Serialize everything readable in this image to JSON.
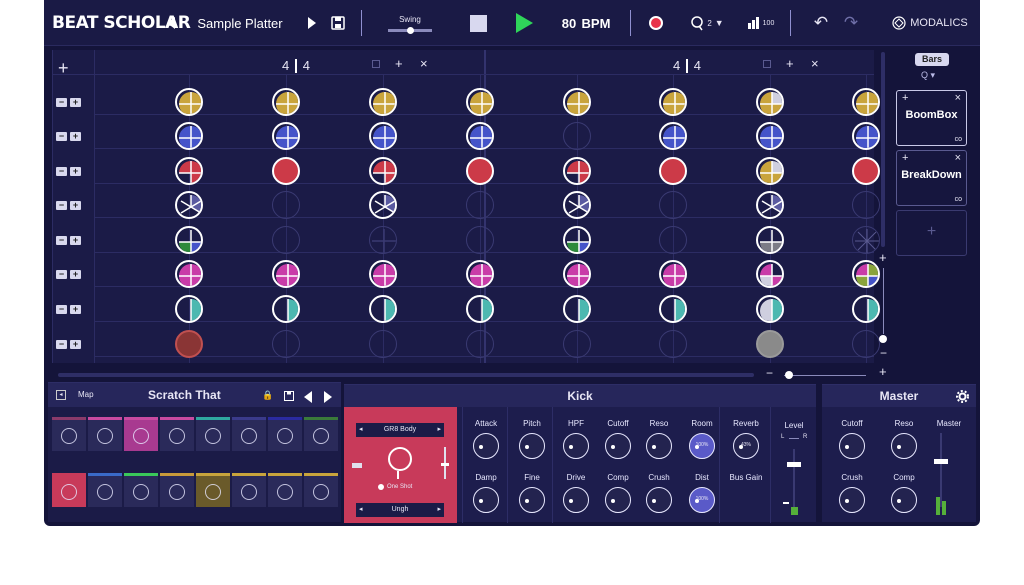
{
  "app": {
    "logo": "BEAT SCHOLAR",
    "pattern_name": "Sample Platter",
    "swing_label": "Swing",
    "bpm": "80",
    "bpm_unit": "BPM",
    "metronome_count": "2",
    "velocity": "100",
    "brand": "MODALICS"
  },
  "grid": {
    "sections": [
      {
        "num": "4",
        "den": "4"
      },
      {
        "num": "4",
        "den": "4"
      }
    ],
    "add_label": "+",
    "close_label": "×",
    "rows": [
      [
        "q4",
        "q4",
        "q4",
        "q4",
        "q4",
        "q4",
        "q4w",
        "q4"
      ],
      [
        "q4b",
        "q4b",
        "q4b",
        "q4b",
        "e",
        "q4b",
        "q4b",
        "q4b"
      ],
      [
        "q4r",
        "red",
        "q4r",
        "red",
        "q4r",
        "red",
        "q4w",
        "red"
      ],
      [
        "pie",
        "e",
        "pie",
        "e",
        "pie",
        "e",
        "pie",
        "e"
      ],
      [
        "q4g",
        "e",
        "eg",
        "e",
        "q4g",
        "e",
        "q4gw",
        "wheel"
      ],
      [
        "q4m",
        "q4m",
        "q4m",
        "q4m",
        "q4m",
        "q4m",
        "q4mw",
        "q4o"
      ],
      [
        "half",
        "half",
        "half",
        "half",
        "half",
        "half",
        "halfw",
        "half"
      ],
      [
        "brown",
        "e",
        "e",
        "e",
        "e",
        "e",
        "grey",
        "e"
      ]
    ]
  },
  "sidebar": {
    "bars_label": "Bars",
    "cards": [
      {
        "name": "BoomBox",
        "tag": "co"
      },
      {
        "name": "BreakDown",
        "tag": "co"
      }
    ],
    "add_label": "+"
  },
  "kit": {
    "map_label": "Map",
    "name": "Scratch That"
  },
  "kick": {
    "title": "Kick",
    "sample_top": "GR8 Body",
    "sample_bottom": "Ungh",
    "one_shot": "One Shot",
    "knobs_row1": [
      "Attack",
      "Pitch",
      "HPF",
      "Cutoff",
      "Reso",
      "Room",
      "Reverb"
    ],
    "knobs_row2": [
      "Damp",
      "Fine",
      "Drive",
      "Comp",
      "Crush",
      "Dist",
      "Bus Gain"
    ],
    "room_value": "100%",
    "reverb_value": "43%",
    "dist_value": "100%",
    "level_label": "Level",
    "l_label": "L",
    "r_label": "R"
  },
  "master": {
    "title": "Master",
    "knobs": [
      "Cutoff",
      "Reso",
      "Crush",
      "Comp"
    ],
    "master_label": "Master"
  },
  "colors": {
    "bg": "#14143a",
    "record": "#e8334a",
    "play": "#2fd55a",
    "kick_panel": "#c83a5a"
  }
}
